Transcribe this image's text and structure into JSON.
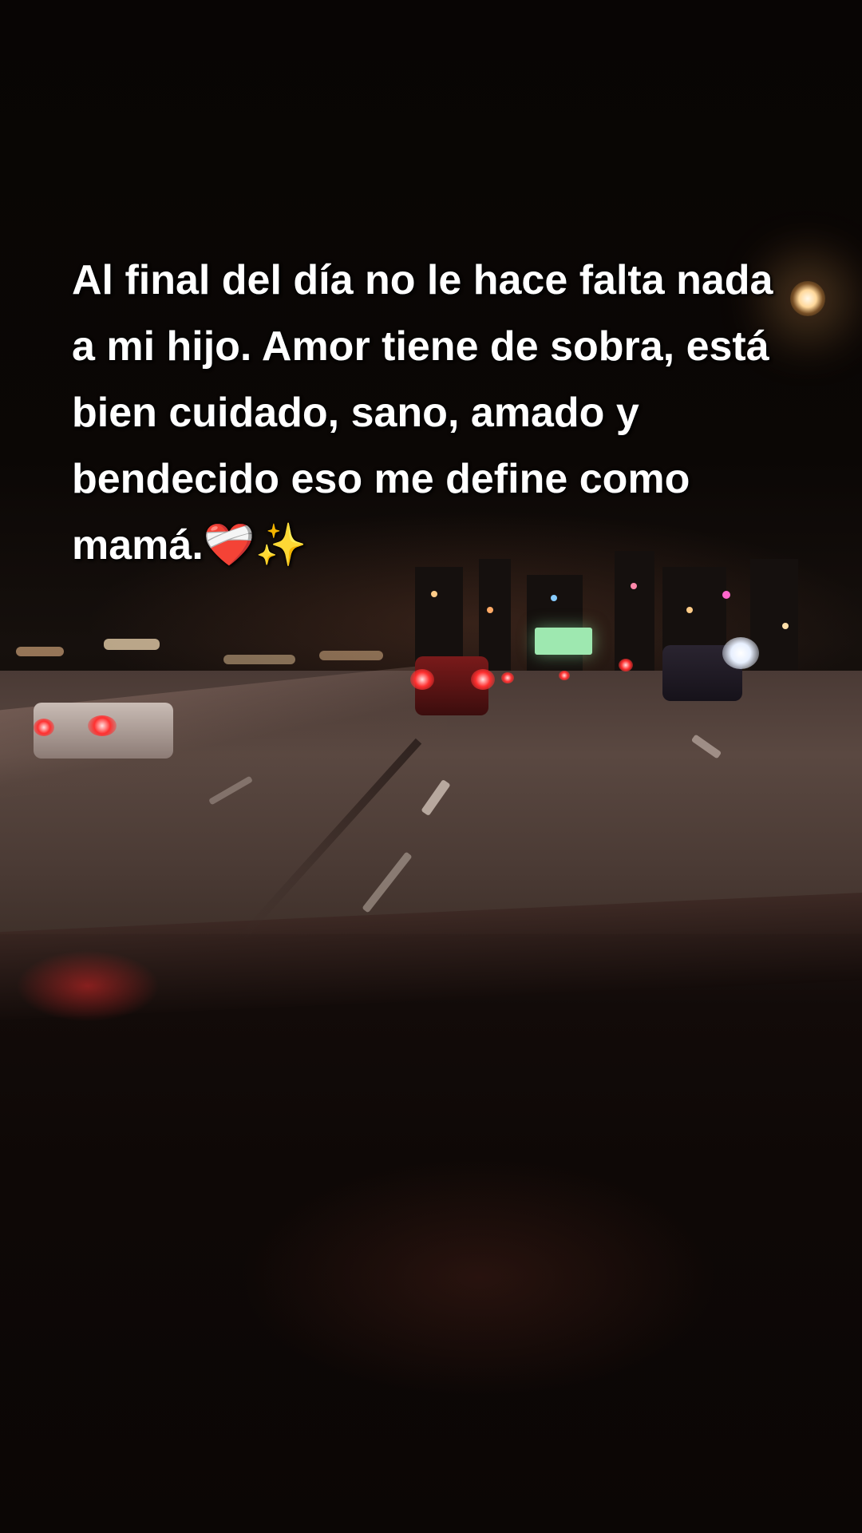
{
  "caption": {
    "text": "Al final del día no le hace falta nada a mi hijo. Amor tiene de sobra, está bien cuidado, sano, amado y bendecido eso me define como mamá.❤️‍🩹✨"
  },
  "scene": {
    "description_icon": "night-highway-dashcam",
    "colors": {
      "sky": "#080504",
      "road": "#4a3a35",
      "taillight": "#ff3030",
      "streetlamp": "#ffd89a",
      "caption_text": "#ffffff"
    }
  }
}
